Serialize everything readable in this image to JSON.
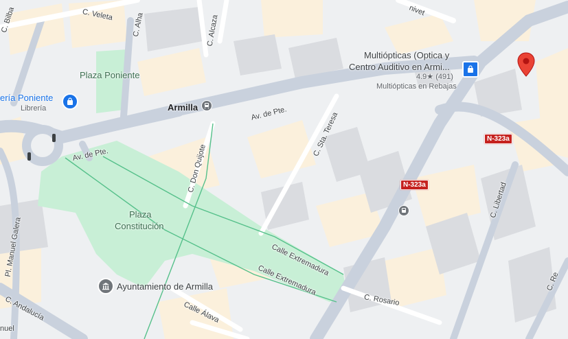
{
  "colors": {
    "road": "#c9d1dd",
    "road_minor": "#ffffff",
    "block_gray": "#e5e7eb",
    "block_beige": "#fbf0dc",
    "park": "#c8efd6",
    "marker_red": "#ea4335",
    "poi_blue": "#1a73e8",
    "shield_red": "#c5221f"
  },
  "streets": {
    "veleta": "C. Veleta",
    "bilbao": "C. Bilba",
    "alha": "C. Alha",
    "alcaza": "C. Alcaza",
    "av_pte_1": "Av. de Pte.",
    "av_pte_2": "Av. de Pte.",
    "don_quijote": "C. Don Quijote",
    "sta_teresa": "C. Sta. Teresa",
    "manuel_galera": "Pl. Manuel Galera",
    "andalucia": "C. Andalucía",
    "extremadura_1": "Calle Extremadura",
    "extremadura_2": "Calle Extremadura",
    "alava": "Calle Álava",
    "rosario": "C. Rosario",
    "libertad": "C. Libertad",
    "nivet": "nivet",
    "re": "C. Re",
    "manuel_bottom": "nuel"
  },
  "places": {
    "plaza_poniente": "Plaza Poniente",
    "plaza_constitucion_1": "Plaza",
    "plaza_constitucion_2": "Constitución",
    "armilla": "Armilla",
    "libreria_name": "ería Poniente",
    "libreria_type": "Librería",
    "ayuntamiento": "Ayuntamiento de Armilla",
    "multiopticas_1": "Multiópticas (Optica y",
    "multiopticas_2": "Centro Auditivo en Armi...",
    "multiopticas_rating": "4.9★ (491)",
    "multiopticas_sub": "Multiópticas en Rebajas"
  },
  "shields": {
    "n323a_top": "N-323a",
    "n323a_mid": "N-323a"
  },
  "icons": {
    "shop": "shopping-bag-icon",
    "bus": "bus-icon",
    "train": "train-icon",
    "townhall": "townhall-icon",
    "pin": "location-pin-icon"
  }
}
